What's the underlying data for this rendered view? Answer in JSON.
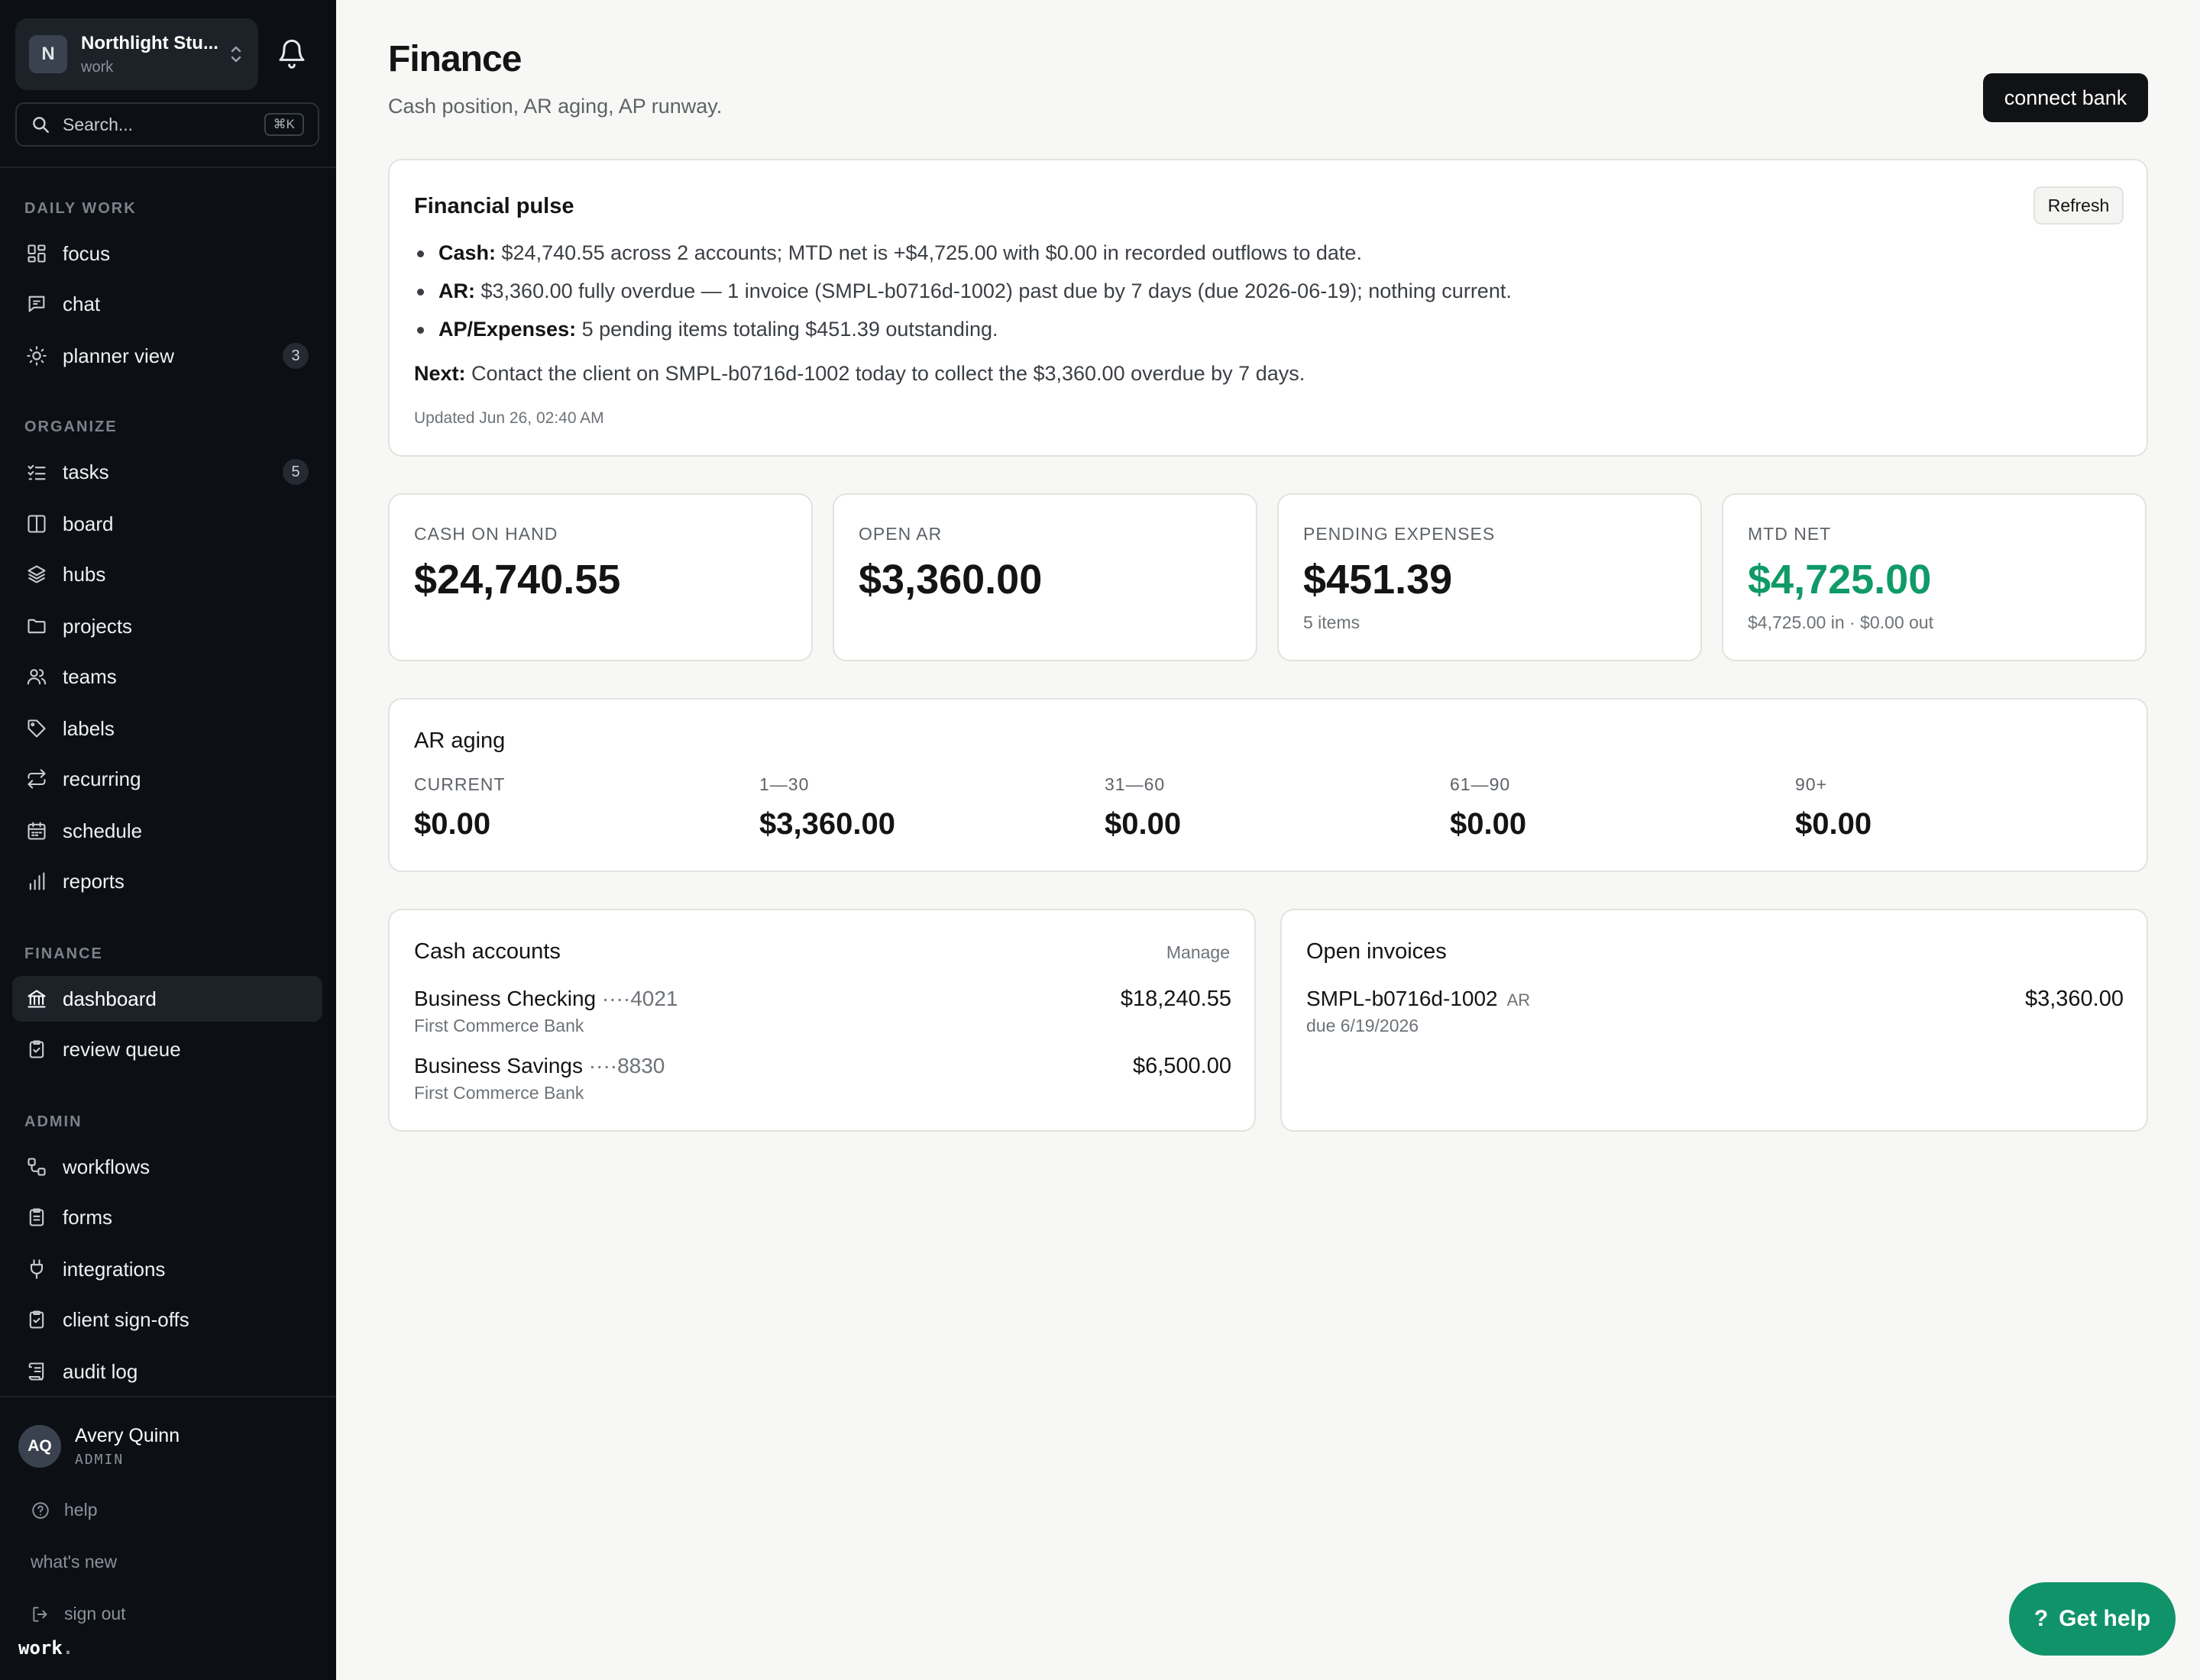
{
  "sidebar": {
    "workspace": {
      "initial": "N",
      "name": "Northlight Stu...",
      "sub": "work"
    },
    "search": {
      "placeholder": "Search...",
      "shortcut": "⌘K"
    },
    "sections": {
      "daily": "DAILY WORK",
      "organize": "ORGANIZE",
      "finance": "FINANCE",
      "admin": "ADMIN"
    },
    "items": {
      "focus": "focus",
      "chat": "chat",
      "planner": "planner view",
      "planner_count": "3",
      "tasks": "tasks",
      "tasks_count": "5",
      "board": "board",
      "hubs": "hubs",
      "projects": "projects",
      "teams": "teams",
      "labels": "labels",
      "recurring": "recurring",
      "schedule": "schedule",
      "reports": "reports",
      "dashboard": "dashboard",
      "review": "review queue",
      "workflows": "workflows",
      "forms": "forms",
      "integrations": "integrations",
      "signoffs": "client sign-offs",
      "audit": "audit log"
    },
    "user": {
      "initials": "AQ",
      "name": "Avery Quinn",
      "role": "ADMIN"
    },
    "footer": {
      "help": "help",
      "whats_new": "what's new",
      "sign_out": "sign out"
    },
    "brand": "work",
    "brand_dot": "."
  },
  "header": {
    "title": "Finance",
    "subtitle": "Cash position, AR aging, AP runway.",
    "connect_label": "connect bank"
  },
  "pulse": {
    "title": "Financial pulse",
    "refresh_label": "Refresh",
    "cash_label": "Cash:",
    "cash_text": " $24,740.55 across 2 accounts; MTD net is +$4,725.00 with $0.00 in recorded outflows to date.",
    "ar_label": "AR:",
    "ar_text": " $3,360.00 fully overdue — 1 invoice (SMPL-b0716d-1002) past due by 7 days (due 2026-06-19); nothing current.",
    "ap_label": "AP/Expenses:",
    "ap_text": " 5 pending items totaling $451.39 outstanding.",
    "next_label": "Next:",
    "next_text": " Contact the client on SMPL-b0716d-1002 today to collect the $3,360.00 overdue by 7 days.",
    "updated": "Updated Jun 26, 02:40 AM"
  },
  "metrics": {
    "cash": {
      "label": "CASH ON HAND",
      "value": "$24,740.55"
    },
    "ar": {
      "label": "OPEN AR",
      "value": "$3,360.00"
    },
    "expenses": {
      "label": "PENDING EXPENSES",
      "value": "$451.39",
      "sub": "5 items"
    },
    "net": {
      "label": "MTD NET",
      "value": "$4,725.00",
      "sub": "$4,725.00 in · $0.00 out",
      "color": "#0f9a68"
    }
  },
  "aging": {
    "title": "AR aging",
    "buckets": [
      {
        "label": "CURRENT",
        "value": "$0.00"
      },
      {
        "label": "1—30",
        "value": "$3,360.00"
      },
      {
        "label": "31—60",
        "value": "$0.00"
      },
      {
        "label": "61—90",
        "value": "$0.00"
      },
      {
        "label": "90+",
        "value": "$0.00"
      }
    ]
  },
  "accounts": {
    "title": "Cash accounts",
    "manage_label": "Manage",
    "rows": [
      {
        "name": "Business Checking",
        "mask": "····4021",
        "bank": "First Commerce Bank",
        "amount": "$18,240.55"
      },
      {
        "name": "Business Savings",
        "mask": "····8830",
        "bank": "First Commerce Bank",
        "amount": "$6,500.00"
      }
    ]
  },
  "invoices": {
    "title": "Open invoices",
    "rows": [
      {
        "id": "SMPL-b0716d-1002",
        "tag": "AR",
        "due": "due 6/19/2026",
        "amount": "$3,360.00"
      }
    ]
  },
  "help_button": {
    "icon": "?",
    "label": "Get help"
  }
}
